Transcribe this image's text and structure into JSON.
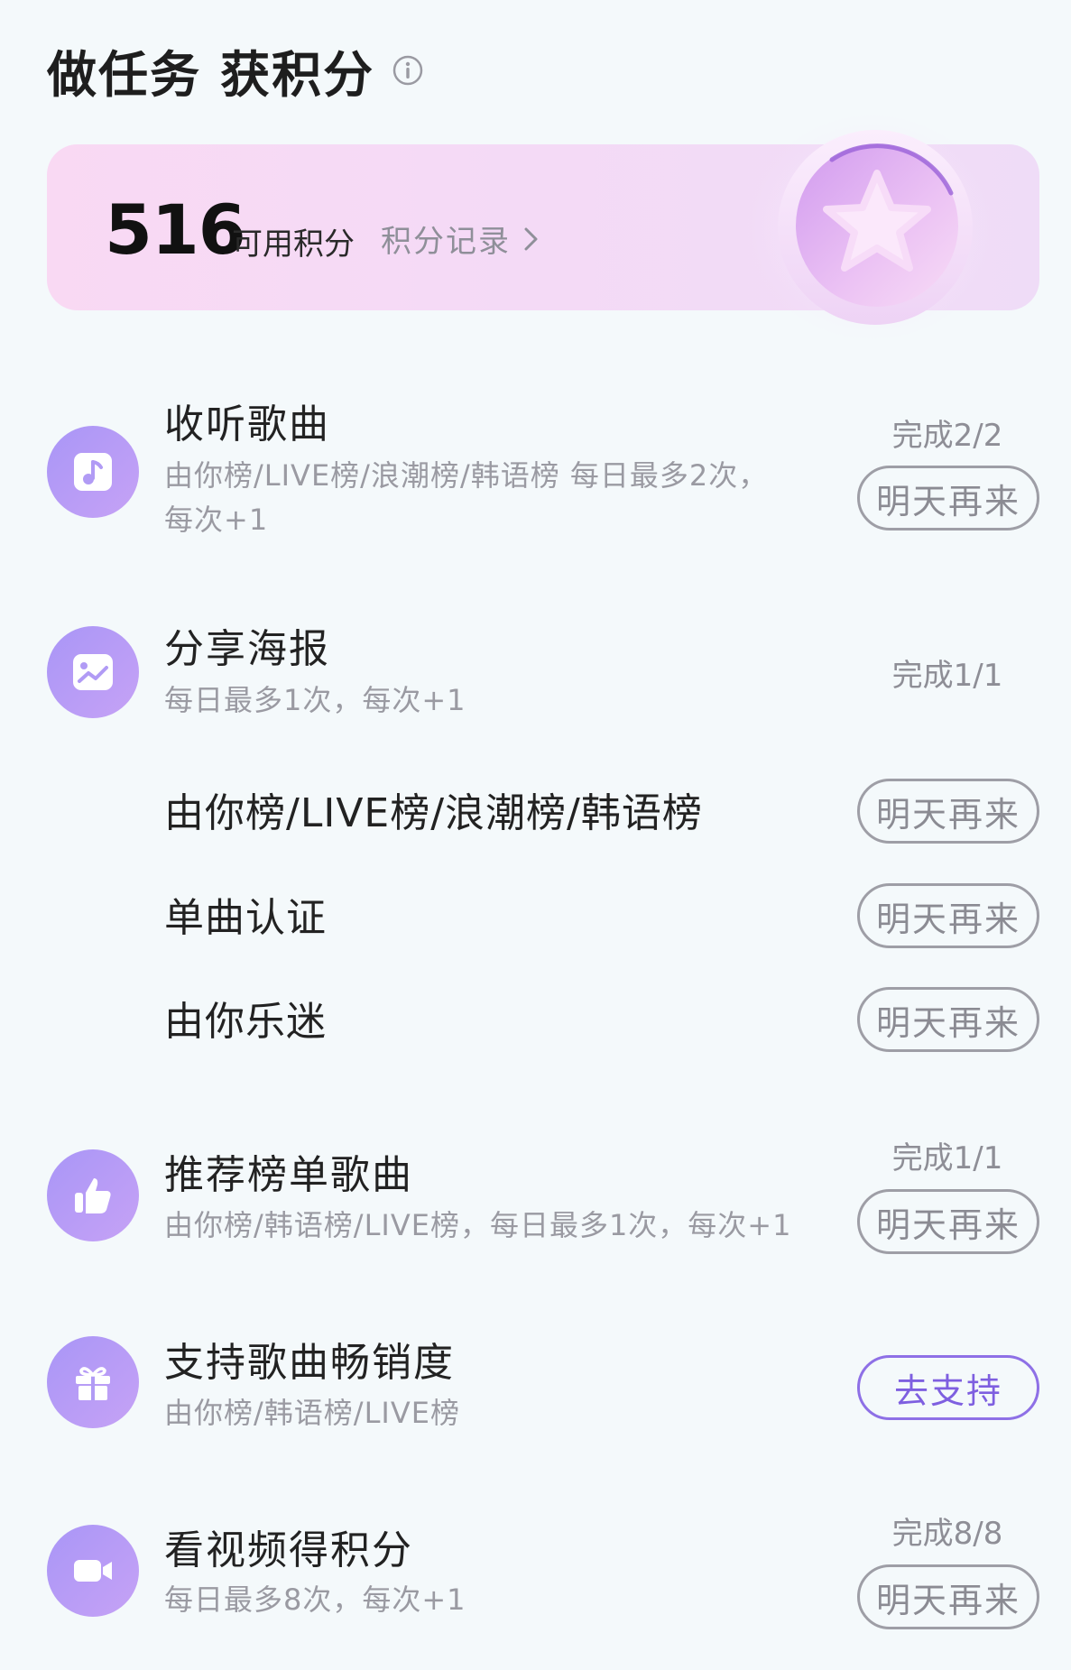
{
  "header": {
    "title": "做任务 获积分",
    "info_icon": "info-circle-icon"
  },
  "points": {
    "value": "516",
    "label": "可用积分",
    "records_label": "积分记录",
    "coin_icon": "star-coin-icon"
  },
  "colors": {
    "accent": "#8e70e6",
    "icon_gradient_start": "#a996f7",
    "icon_gradient_end": "#c6a2f5",
    "card_bg": "#f7d9f5",
    "page_bg": "#f4f9fb"
  },
  "tasks": {
    "listen": {
      "icon": "music-note-icon",
      "title": "收听歌曲",
      "desc_line1": "由你榜/LIVE榜/浪潮榜/韩语榜 每日最多2次，",
      "desc_line2": "每次+1",
      "status": "完成2/2",
      "button": "明天再来"
    },
    "poster": {
      "icon": "image-icon",
      "title": "分享海报",
      "desc": "每日最多1次，每次+1",
      "status": "完成1/1",
      "subitems": [
        {
          "label": "由你榜/LIVE榜/浪潮榜/韩语榜",
          "button": "明天再来"
        },
        {
          "label": "单曲认证",
          "button": "明天再来"
        },
        {
          "label": "由你乐迷",
          "button": "明天再来"
        }
      ]
    },
    "recommend": {
      "icon": "thumbs-up-icon",
      "title": "推荐榜单歌曲",
      "desc": "由你榜/韩语榜/LIVE榜，每日最多1次，每次+1",
      "status": "完成1/1",
      "button": "明天再来"
    },
    "support": {
      "icon": "gift-icon",
      "title": "支持歌曲畅销度",
      "desc": "由你榜/韩语榜/LIVE榜",
      "button": "去支持"
    },
    "video": {
      "icon": "video-camera-icon",
      "title": "看视频得积分",
      "desc": "每日最多8次，每次+1",
      "status": "完成8/8",
      "button": "明天再来"
    }
  }
}
